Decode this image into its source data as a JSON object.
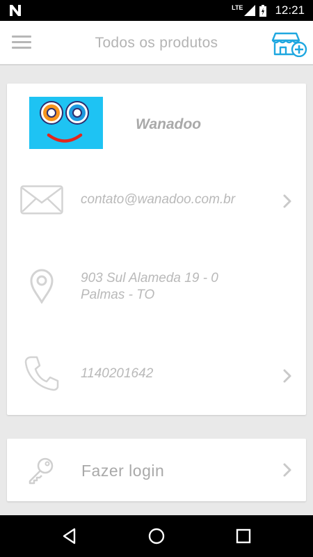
{
  "status_bar": {
    "network": "LTE",
    "time": "12:21"
  },
  "app_bar": {
    "title": "Todos os produtos",
    "menu_icon": "menu-icon",
    "action_icon": "store-add-icon",
    "accent_color": "#1ea7e0"
  },
  "store": {
    "name": "Wanadoo",
    "logo_bg_color": "#1ec3f3",
    "email": "contato@wanadoo.com.br",
    "address_line1": "903 Sul Alameda 19 - 0",
    "address_line2": "Palmas - TO",
    "phone": "1140201642"
  },
  "login": {
    "label": "Fazer login"
  },
  "nav_bar": {
    "icons": [
      "back-icon",
      "home-icon",
      "recents-icon"
    ]
  }
}
